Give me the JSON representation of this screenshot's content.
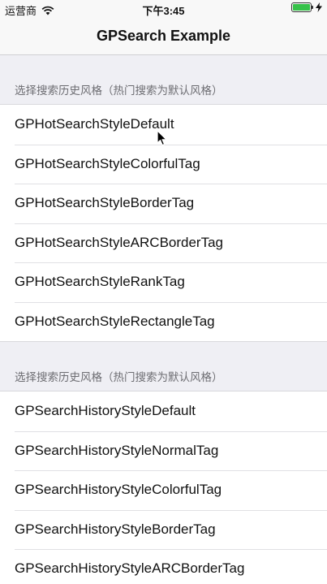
{
  "status_bar": {
    "carrier": "运营商",
    "time": "下午3:45",
    "icons": [
      "wifi-icon",
      "battery-icon",
      "charging-bolt-icon"
    ]
  },
  "nav": {
    "title": "GPSearch Example"
  },
  "sections": [
    {
      "header": "选择搜索历史风格（热门搜索为默认风格）",
      "rows": [
        "GPHotSearchStyleDefault",
        "GPHotSearchStyleColorfulTag",
        "GPHotSearchStyleBorderTag",
        "GPHotSearchStyleARCBorderTag",
        "GPHotSearchStyleRankTag",
        "GPHotSearchStyleRectangleTag"
      ]
    },
    {
      "header": "选择搜索历史风格（热门搜索为默认风格）",
      "rows": [
        "GPSearchHistoryStyleDefault",
        "GPSearchHistoryStyleNormalTag",
        "GPSearchHistoryStyleColorfulTag",
        "GPSearchHistoryStyleBorderTag",
        "GPSearchHistoryStyleARCBorderTag"
      ]
    }
  ]
}
